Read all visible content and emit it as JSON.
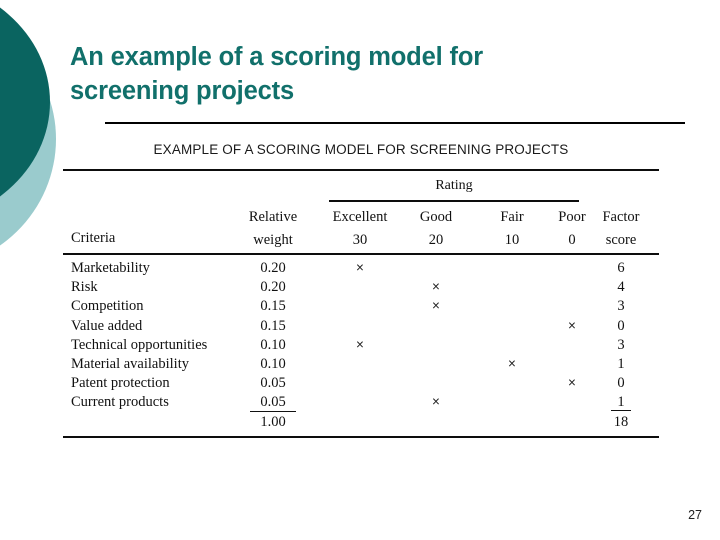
{
  "slide": {
    "title": "An example of a scoring model for\nscreening projects",
    "page_number": "27",
    "accent_dark": "#0A6460",
    "accent_light": "#9ACBCD",
    "title_color": "#11706B"
  },
  "table": {
    "caption": "EXAMPLE OF A SCORING MODEL FOR SCREENING PROJECTS",
    "rating_group_label": "Rating",
    "criteria_header": "Criteria",
    "relative_weight_header_line1": "Relative",
    "relative_weight_header_line2": "weight",
    "factor_score_header_line1": "Factor",
    "factor_score_header_line2": "score",
    "rating_columns": [
      {
        "label": "Excellent",
        "value": "30"
      },
      {
        "label": "Good",
        "value": "20"
      },
      {
        "label": "Fair",
        "value": "10"
      },
      {
        "label": "Poor",
        "value": "0"
      }
    ],
    "mark_glyph": "×",
    "rows": [
      {
        "criteria": "Marketability",
        "weight": "0.20",
        "rating": "Excellent",
        "factor_score": "6"
      },
      {
        "criteria": "Risk",
        "weight": "0.20",
        "rating": "Good",
        "factor_score": "4"
      },
      {
        "criteria": "Competition",
        "weight": "0.15",
        "rating": "Good",
        "factor_score": "3"
      },
      {
        "criteria": "Value added",
        "weight": "0.15",
        "rating": "Poor",
        "factor_score": "0"
      },
      {
        "criteria": "Technical opportunities",
        "weight": "0.10",
        "rating": "Excellent",
        "factor_score": "3"
      },
      {
        "criteria": "Material availability",
        "weight": "0.10",
        "rating": "Fair",
        "factor_score": "1"
      },
      {
        "criteria": "Patent protection",
        "weight": "0.05",
        "rating": "Poor",
        "factor_score": "0"
      },
      {
        "criteria": "Current products",
        "weight": "0.05",
        "rating": "Good",
        "factor_score": "1"
      }
    ],
    "totals": {
      "weight_total": "1.00",
      "factor_score_total": "18"
    }
  }
}
